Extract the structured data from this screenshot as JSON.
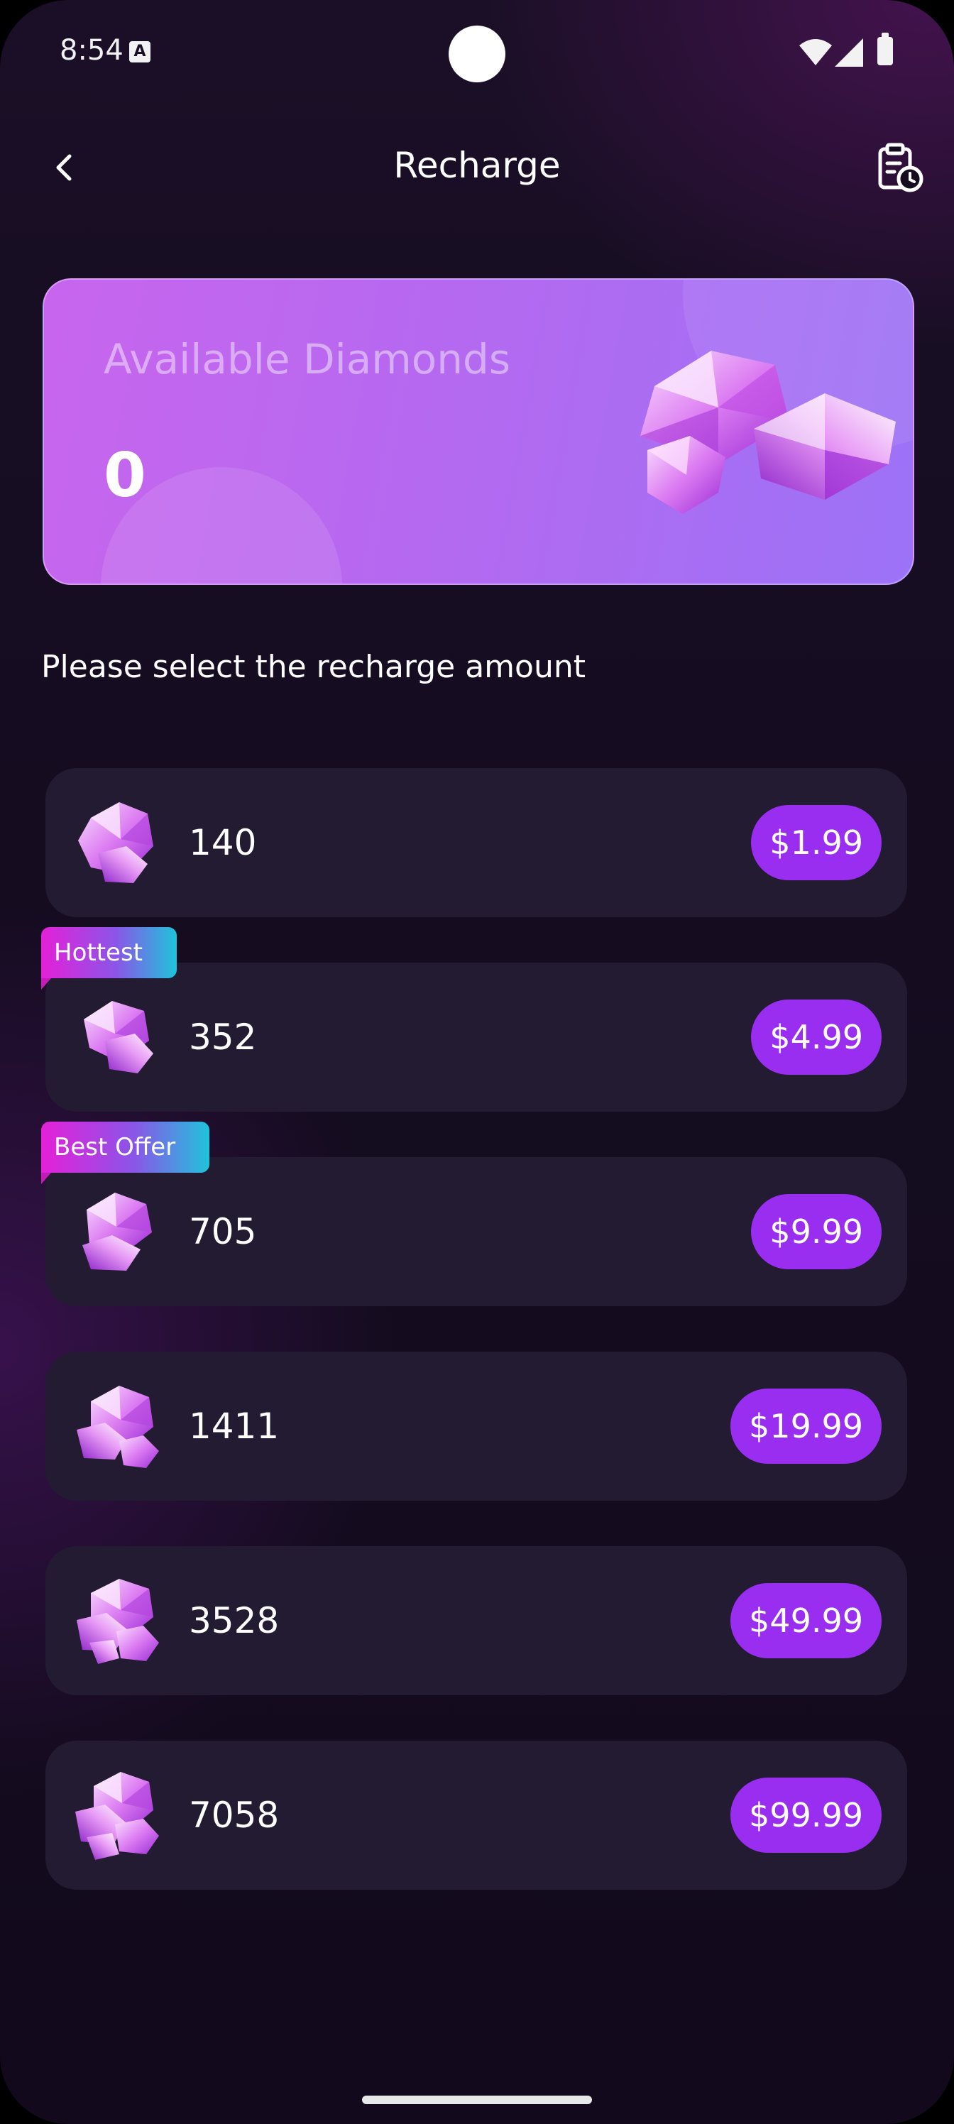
{
  "status_bar": {
    "time": "8:54",
    "notification_icon": "a-icon"
  },
  "header": {
    "title": "Recharge",
    "back_icon": "chevron-left-icon",
    "history_icon": "clipboard-clock-icon"
  },
  "balance": {
    "label": "Available Diamonds",
    "value": "0"
  },
  "section": {
    "label": "Please select the recharge amount"
  },
  "packages": [
    {
      "amount": "140",
      "price": "$1.99",
      "badge": ""
    },
    {
      "amount": "352",
      "price": "$4.99",
      "badge": "Hottest"
    },
    {
      "amount": "705",
      "price": "$9.99",
      "badge": "Best Offer"
    },
    {
      "amount": "1411",
      "price": "$19.99",
      "badge": ""
    },
    {
      "amount": "3528",
      "price": "$49.99",
      "badge": ""
    },
    {
      "amount": "7058",
      "price": "$99.99",
      "badge": ""
    }
  ],
  "colors": {
    "accent": "#9a2ef0",
    "card": "#221b31",
    "background": "#150c20"
  }
}
